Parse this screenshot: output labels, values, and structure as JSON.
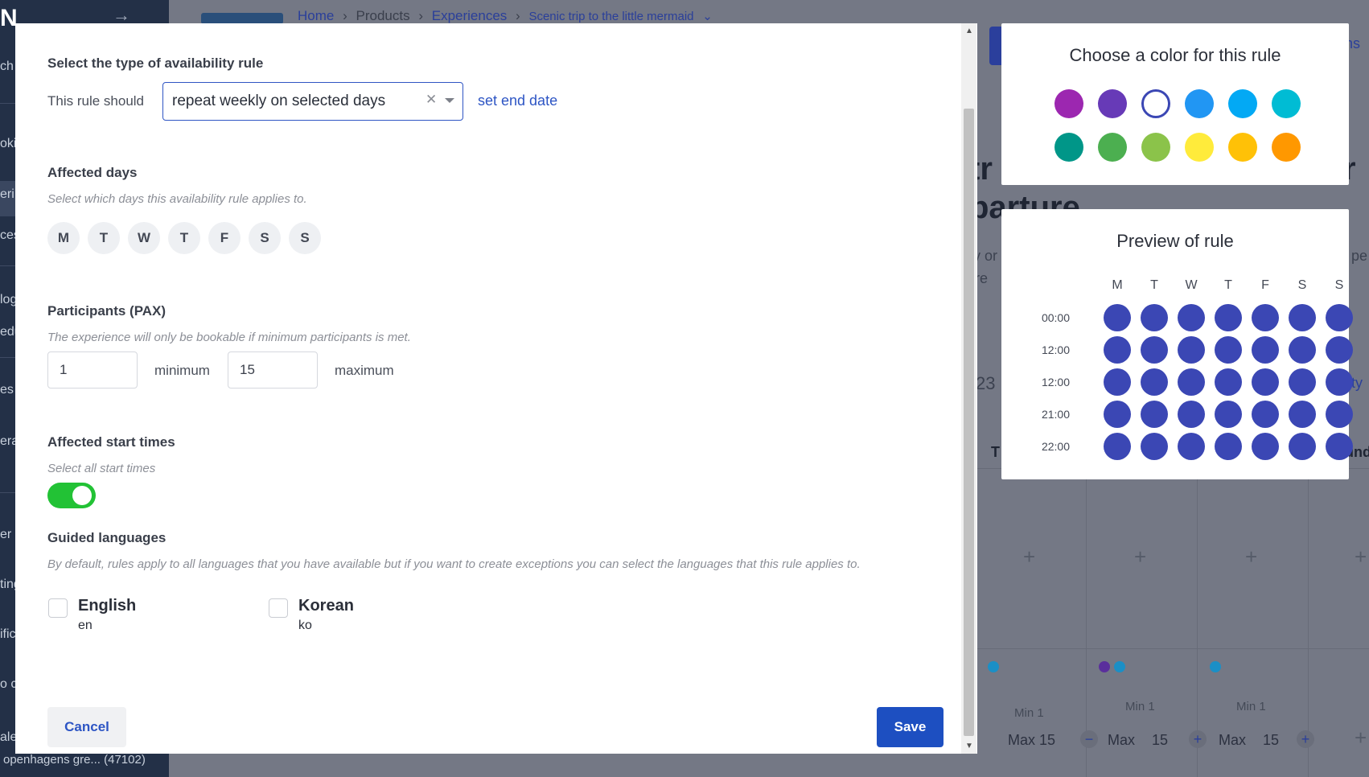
{
  "background": {
    "sidebar": {
      "logo": "N",
      "items": [
        "ch",
        "oki",
        "eri",
        "ces",
        "log",
        "edu",
        "es",
        "era",
        "er s",
        "ting",
        "ific",
        "o c",
        "ale"
      ],
      "footer_name": "openhagens gre...",
      "footer_count": "(47102)"
    },
    "breadcrumb": {
      "home": "Home",
      "products": "Products",
      "experiences": "Experiences",
      "current": "Scenic trip to the little mermaid"
    },
    "heading_line1": "tr",
    "heading_line1_right": "r",
    "heading_line2": "parture",
    "text_left_1": "y or",
    "text_left_2": "re",
    "text_right_1": "pe",
    "number_23": "23",
    "link_right_top": "ns",
    "link_right_mid": "ity",
    "col_header_left": "T",
    "col_header_right": "und",
    "min_label": "Min 1",
    "max_label": "Max 15",
    "max_short": "Max",
    "max_value": "15"
  },
  "modal": {
    "rule_type_title": "Select the type of availability rule",
    "rule_should_label": "This rule should",
    "rule_select_value": "repeat weekly on selected days",
    "set_end_date": "set end date",
    "affected_days_title": "Affected days",
    "affected_days_hint": "Select which days this availability rule applies to.",
    "days": [
      "M",
      "T",
      "W",
      "T",
      "F",
      "S",
      "S"
    ],
    "pax_title": "Participants (PAX)",
    "pax_hint": "The experience will only be bookable if minimum participants is met.",
    "pax_min_value": "1",
    "pax_min_label": "minimum",
    "pax_max_value": "15",
    "pax_max_label": "maximum",
    "start_times_title": "Affected start times",
    "start_times_hint": "Select all start times",
    "select_all_start_times_on": true,
    "languages_title": "Guided languages",
    "languages_hint": "By default, rules apply to all languages that you have available but if you want to create exceptions you can select the languages that this rule applies to.",
    "languages": [
      {
        "name": "English",
        "code": "en",
        "checked": false
      },
      {
        "name": "Korean",
        "code": "ko",
        "checked": false
      }
    ],
    "cancel_label": "Cancel",
    "save_label": "Save"
  },
  "color_panel": {
    "title": "Choose a color for this rule",
    "colors": [
      "#9c27b0",
      "#673ab7",
      "#3f51b5",
      "#2196f3",
      "#03a9f4",
      "#00bcd4",
      "#009688",
      "#4caf50",
      "#8bc34a",
      "#ffeb3b",
      "#ffc107",
      "#ff9800"
    ],
    "selected_color": "#3f51b5"
  },
  "preview_panel": {
    "title": "Preview of rule",
    "days": [
      "M",
      "T",
      "W",
      "T",
      "F",
      "S",
      "S"
    ],
    "times": [
      "00:00",
      "12:00",
      "12:00",
      "21:00",
      "22:00"
    ],
    "dot_color": "#3b47b4"
  }
}
